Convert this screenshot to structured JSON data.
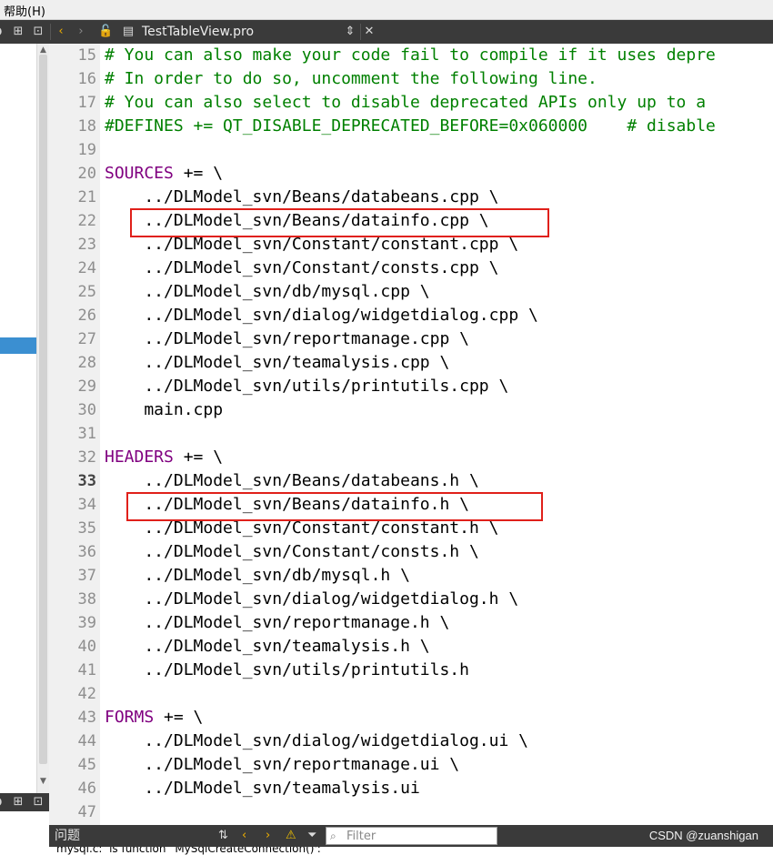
{
  "menubar": {
    "help_label": "帮助(H)"
  },
  "toolbar": {
    "file_name": "TestTableView.pro",
    "icons": [
      "split-icon",
      "close-panel-icon",
      "back-icon",
      "forward-icon",
      "lock-icon",
      "file-icon",
      "dropdown-icon",
      "close-icon"
    ]
  },
  "editor": {
    "lines": [
      {
        "num": "15",
        "text": "# You can also make your code fail to compile if it uses depre",
        "kind": "comment"
      },
      {
        "num": "16",
        "text": "# In order to do so, uncomment the following line.",
        "kind": "comment"
      },
      {
        "num": "17",
        "text": "# You can also select to disable deprecated APIs only up to a",
        "kind": "comment"
      },
      {
        "num": "18",
        "text": "#DEFINES += QT_DISABLE_DEPRECATED_BEFORE=0x060000    # disable",
        "kind": "comment"
      },
      {
        "num": "19",
        "text": "",
        "kind": "plain"
      },
      {
        "num": "20",
        "var": "SOURCES",
        "text": " += \\",
        "kind": "var"
      },
      {
        "num": "21",
        "text": "    ../DLModel_svn/Beans/databeans.cpp \\",
        "kind": "plain"
      },
      {
        "num": "22",
        "text": "    ../DLModel_svn/Beans/datainfo.cpp \\",
        "kind": "plain"
      },
      {
        "num": "23",
        "text": "    ../DLModel_svn/Constant/constant.cpp \\",
        "kind": "plain"
      },
      {
        "num": "24",
        "text": "    ../DLModel_svn/Constant/consts.cpp \\",
        "kind": "plain"
      },
      {
        "num": "25",
        "text": "    ../DLModel_svn/db/mysql.cpp \\",
        "kind": "plain"
      },
      {
        "num": "26",
        "text": "    ../DLModel_svn/dialog/widgetdialog.cpp \\",
        "kind": "plain"
      },
      {
        "num": "27",
        "text": "    ../DLModel_svn/reportmanage.cpp \\",
        "kind": "plain"
      },
      {
        "num": "28",
        "text": "    ../DLModel_svn/teamalysis.cpp \\",
        "kind": "plain"
      },
      {
        "num": "29",
        "text": "    ../DLModel_svn/utils/printutils.cpp \\",
        "kind": "plain"
      },
      {
        "num": "30",
        "text": "    main.cpp",
        "kind": "plain"
      },
      {
        "num": "31",
        "text": "",
        "kind": "plain"
      },
      {
        "num": "32",
        "var": "HEADERS",
        "text": " += \\",
        "kind": "var"
      },
      {
        "num": "33",
        "text": "    ../DLModel_svn/Beans/databeans.h \\",
        "kind": "plain",
        "current": true
      },
      {
        "num": "34",
        "text": "    ../DLModel_svn/Beans/datainfo.h \\",
        "kind": "plain"
      },
      {
        "num": "35",
        "text": "    ../DLModel_svn/Constant/constant.h \\",
        "kind": "plain"
      },
      {
        "num": "36",
        "text": "    ../DLModel_svn/Constant/consts.h \\",
        "kind": "plain"
      },
      {
        "num": "37",
        "text": "    ../DLModel_svn/db/mysql.h \\",
        "kind": "plain"
      },
      {
        "num": "38",
        "text": "    ../DLModel_svn/dialog/widgetdialog.h \\",
        "kind": "plain"
      },
      {
        "num": "39",
        "text": "    ../DLModel_svn/reportmanage.h \\",
        "kind": "plain"
      },
      {
        "num": "40",
        "text": "    ../DLModel_svn/teamalysis.h \\",
        "kind": "plain"
      },
      {
        "num": "41",
        "text": "    ../DLModel_svn/utils/printutils.h",
        "kind": "plain"
      },
      {
        "num": "42",
        "text": "",
        "kind": "plain"
      },
      {
        "num": "43",
        "var": "FORMS",
        "text": " += \\",
        "kind": "var"
      },
      {
        "num": "44",
        "text": "    ../DLModel_svn/dialog/widgetdialog.ui \\",
        "kind": "plain"
      },
      {
        "num": "45",
        "text": "    ../DLModel_svn/reportmanage.ui \\",
        "kind": "plain"
      },
      {
        "num": "46",
        "text": "    ../DLModel_svn/teamalysis.ui",
        "kind": "plain"
      },
      {
        "num": "47",
        "text": "",
        "kind": "plain"
      }
    ],
    "highlighted_lines": [
      "22",
      "34"
    ]
  },
  "issues": {
    "title": "问题",
    "filter_placeholder": "Filter",
    "watermark": "CSDN @zuanshigan",
    "first_issue": "mysql.c:  is function `MySqlCreateConnection()':"
  },
  "colors": {
    "comment": "#008000",
    "variable": "#800080",
    "highlight_box": "#e0201a",
    "toolbar_bg": "#3a3a3a",
    "selection": "#3b8fd1"
  }
}
